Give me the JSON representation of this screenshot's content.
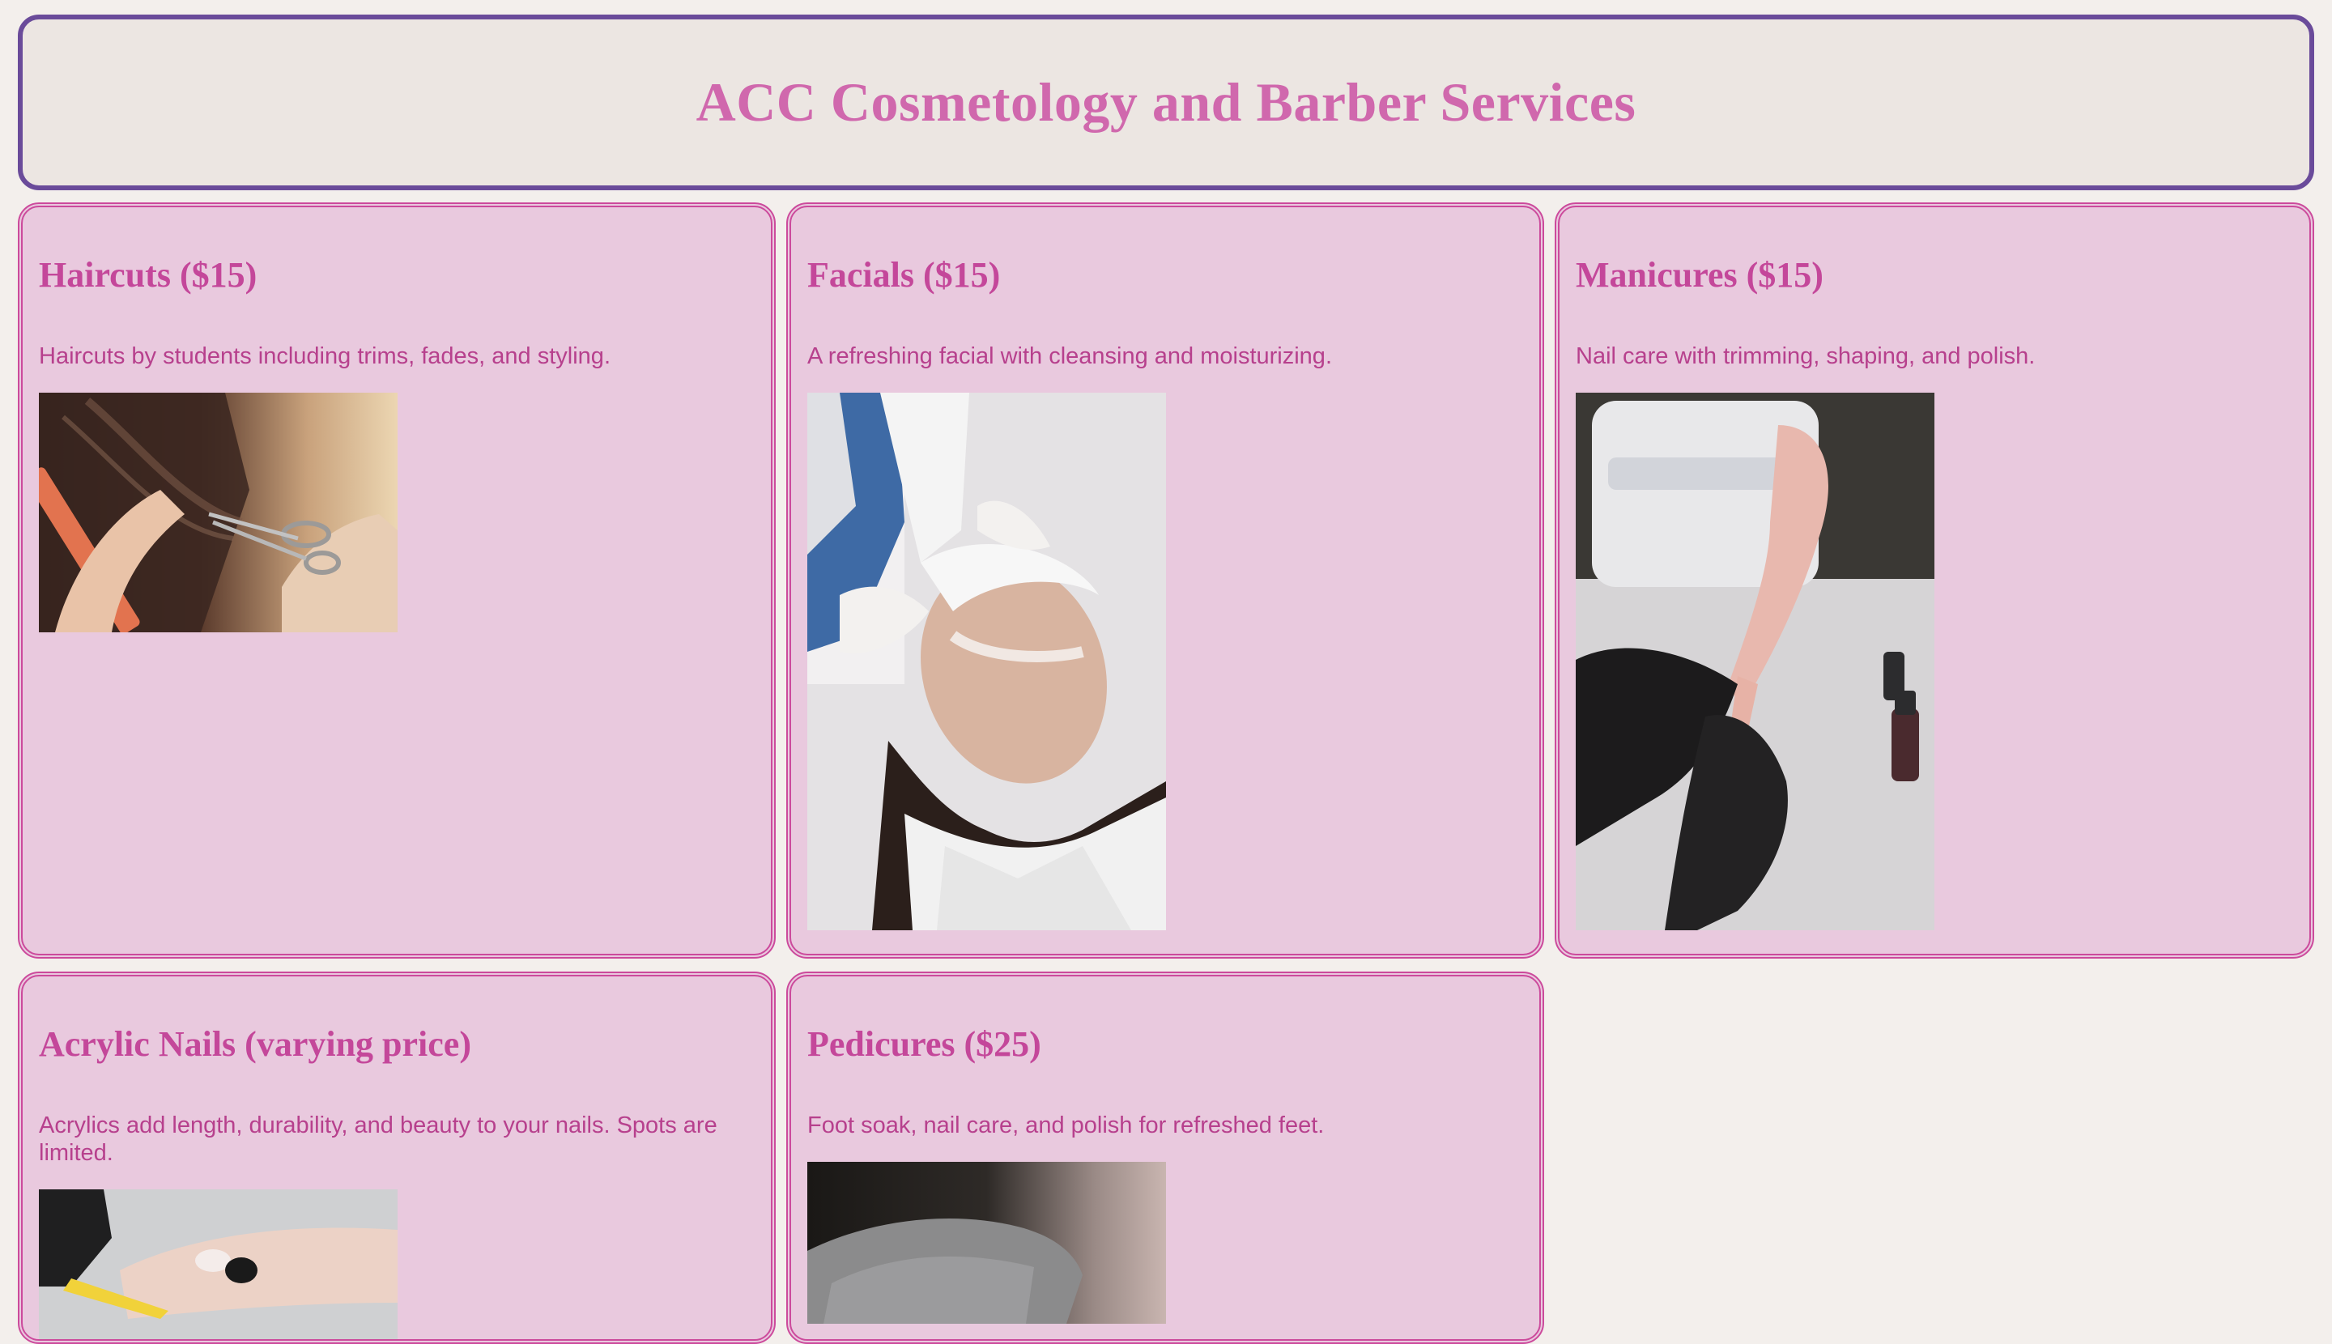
{
  "header": {
    "title": "ACC Cosmetology and Barber Services"
  },
  "services": [
    {
      "title": "Haircuts ($15)",
      "description": "Haircuts by students including trims, fades, and styling."
    },
    {
      "title": "Facials ($15)",
      "description": "A refreshing facial with cleansing and moisturizing."
    },
    {
      "title": "Manicures ($15)",
      "description": "Nail care with trimming, shaping, and polish."
    },
    {
      "title": "Acrylic Nails (varying price)",
      "description": "Acrylics add length, durability, and beauty to your nails. Spots are limited."
    },
    {
      "title": "Pedicures ($25)",
      "description": "Foot soak, nail care, and polish for refreshed feet."
    }
  ],
  "colors": {
    "page_background": "#f3efec",
    "header_background": "#ece6e2",
    "header_border": "#6a4b9a",
    "title_pink": "#d068ad",
    "card_background": "#e9c9de",
    "card_border": "#cc4a9c",
    "card_text": "#c4479a"
  }
}
